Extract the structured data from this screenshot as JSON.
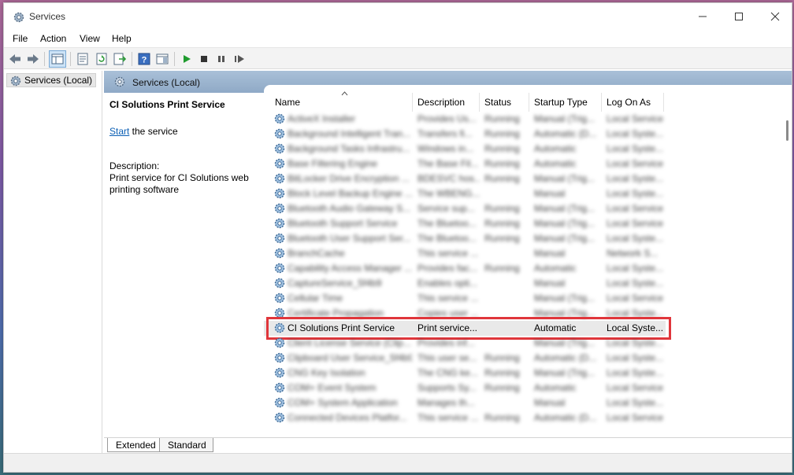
{
  "window": {
    "title": "Services"
  },
  "menu": [
    "File",
    "Action",
    "View",
    "Help"
  ],
  "tree": {
    "root_label": "Services (Local)"
  },
  "pane": {
    "header": "Services (Local)"
  },
  "detail": {
    "service_name": "CI Solutions Print Service",
    "start_link": "Start",
    "start_suffix": " the service",
    "description_label": "Description:",
    "description": "Print service for CI Solutions web printing software"
  },
  "columns": [
    "Name",
    "Description",
    "Status",
    "Startup Type",
    "Log On As"
  ],
  "rows": [
    {
      "name": "ActiveX Installer",
      "description": "Provides Us...",
      "status": "Running",
      "startup": "Manual (Trig...",
      "logon": "Local Service"
    },
    {
      "name": "Background Intelligent Tran...",
      "description": "Transfers fi...",
      "status": "Running",
      "startup": "Automatic (D...",
      "logon": "Local Syste..."
    },
    {
      "name": "Background Tasks Infrastru...",
      "description": "Windows in...",
      "status": "Running",
      "startup": "Automatic",
      "logon": "Local Syste..."
    },
    {
      "name": "Base Filtering Engine",
      "description": "The Base Fil...",
      "status": "Running",
      "startup": "Automatic",
      "logon": "Local Service"
    },
    {
      "name": "BitLocker Drive Encryption ...",
      "description": "BDESVC hos...",
      "status": "Running",
      "startup": "Manual (Trig...",
      "logon": "Local Syste..."
    },
    {
      "name": "Block Level Backup Engine ...",
      "description": "The WBENG...",
      "status": "",
      "startup": "Manual",
      "logon": "Local Syste..."
    },
    {
      "name": "Bluetooth Audio Gateway S...",
      "description": "Service sup...",
      "status": "Running",
      "startup": "Manual (Trig...",
      "logon": "Local Service"
    },
    {
      "name": "Bluetooth Support Service",
      "description": "The Bluetoo...",
      "status": "Running",
      "startup": "Manual (Trig...",
      "logon": "Local Service"
    },
    {
      "name": "Bluetooth User Support Ser...",
      "description": "The Bluetoo...",
      "status": "Running",
      "startup": "Manual (Trig...",
      "logon": "Local Syste..."
    },
    {
      "name": "BranchCache",
      "description": "This service ...",
      "status": "",
      "startup": "Manual",
      "logon": "Network S..."
    },
    {
      "name": "Capability Access Manager ...",
      "description": "Provides fac...",
      "status": "Running",
      "startup": "Automatic",
      "logon": "Local Syste..."
    },
    {
      "name": "CaptureService_5f4b9",
      "description": "Enables opti...",
      "status": "",
      "startup": "Manual",
      "logon": "Local Syste..."
    },
    {
      "name": "Cellular Time",
      "description": "This service ...",
      "status": "",
      "startup": "Manual (Trig...",
      "logon": "Local Service"
    },
    {
      "name": "Certificate Propagation",
      "description": "Copies user ...",
      "status": "",
      "startup": "Manual (Trig...",
      "logon": "Local Syste..."
    },
    {
      "name": "CI Solutions Print Service",
      "description": "Print service...",
      "status": "",
      "startup": "Automatic",
      "logon": "Local Syste...",
      "highlight": true
    },
    {
      "name": "Client License Service (Clip...",
      "description": "Provides inf...",
      "status": "",
      "startup": "Manual (Trig...",
      "logon": "Local Syste..."
    },
    {
      "name": "Clipboard User Service_5f4b9",
      "description": "This user se...",
      "status": "Running",
      "startup": "Automatic (D...",
      "logon": "Local Syste..."
    },
    {
      "name": "CNG Key Isolation",
      "description": "The CNG ke...",
      "status": "Running",
      "startup": "Manual (Trig...",
      "logon": "Local Syste..."
    },
    {
      "name": "COM+ Event System",
      "description": "Supports Sy...",
      "status": "Running",
      "startup": "Automatic",
      "logon": "Local Service"
    },
    {
      "name": "COM+ System Application",
      "description": "Manages th...",
      "status": "",
      "startup": "Manual",
      "logon": "Local Syste..."
    },
    {
      "name": "Connected Devices Platfor...",
      "description": "This service ...",
      "status": "Running",
      "startup": "Automatic (D...",
      "logon": "Local Service"
    }
  ],
  "tabs": [
    "Extended",
    "Standard"
  ]
}
